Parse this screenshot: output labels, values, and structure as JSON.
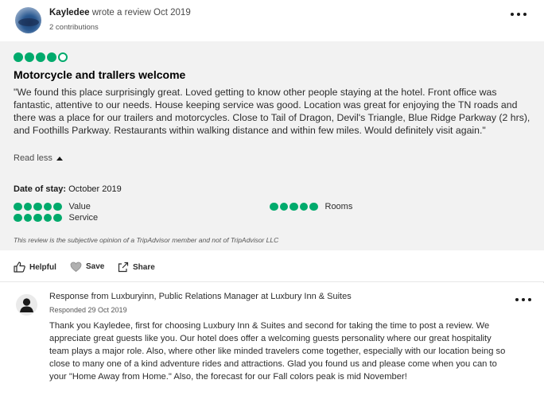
{
  "review": {
    "reviewer_name": "Kayledee",
    "action_text": " wrote a review Oct 2019",
    "contributions": "2 contributions",
    "rating": 4,
    "rating_max": 5,
    "title": "Motorcycle and trallers welcome",
    "text": "\"We found this place surprisingly great. Loved getting to know other people staying at the hotel. Front office was fantastic, attentive to our needs. House keeping service was good. Location was great for enjoying the TN roads and there was a place for our trailers and motorcycles. Close to Tail of Dragon, Devil's Triangle, Blue Ridge Parkway (2 hrs), and Foothills Parkway. Restaurants within walking distance and within few miles. Would definitely visit again.\"",
    "read_less": "Read less",
    "date_of_stay_label": "Date of stay:",
    "date_of_stay_value": " October 2019",
    "sub_ratings": [
      {
        "label": "Value",
        "rating": 5
      },
      {
        "label": "Rooms",
        "rating": 5
      },
      {
        "label": "Service",
        "rating": 5
      }
    ],
    "disclaimer": "This review is the subjective opinion of a TripAdvisor member and not of TripAdvisor LLC"
  },
  "actions": {
    "helpful": "Helpful",
    "save": "Save",
    "share": "Share"
  },
  "response": {
    "title": "Response from Luxburyinn, Public Relations Manager at Luxbury Inn & Suites",
    "date": "Responded 29 Oct 2019",
    "text": "Thank you Kayledee, first for choosing Luxbury Inn & Suites and second for taking the time to post a review. We appreciate great guests like you. Our hotel does offer a welcoming guests personality where our great hospitality team plays a major role. Also, where other like minded travelers come together, especially with our location being so close to many one of a kind adventure rides and attractions. Glad you found us and please come when you can to your \"Home Away from Home.\" Also, the forecast for our Fall colors peak is mid November!"
  },
  "colors": {
    "bubble_green": "#00aa6c",
    "body_bg": "#f2f2f2"
  },
  "icons": [
    "more-options-icon",
    "thumbs-up-icon",
    "heart-icon",
    "share-icon",
    "user-icon",
    "caret-up-icon"
  ]
}
